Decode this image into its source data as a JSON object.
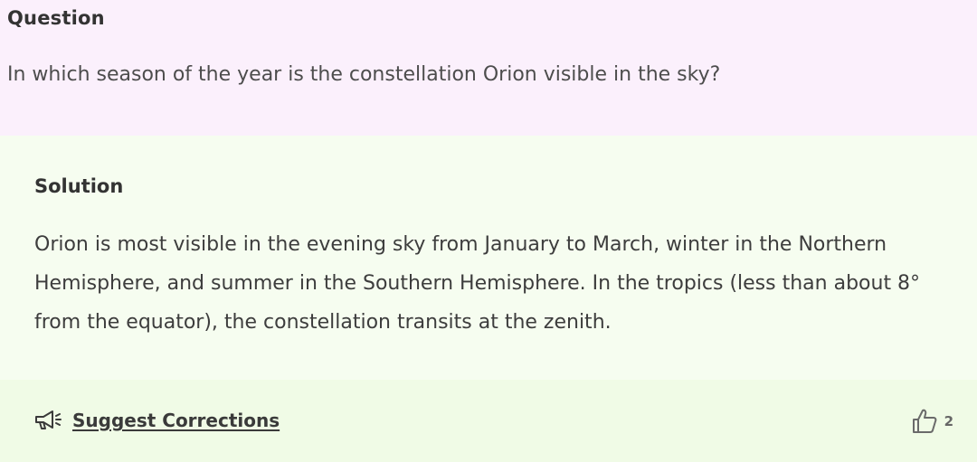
{
  "question": {
    "title": "Question",
    "text": "In which season of the year is the constellation Orion visible in the sky?"
  },
  "solution": {
    "title": "Solution",
    "text": "Orion is most visible in the evening sky from January to March, winter in the Northern Hemisphere, and summer in the Southern Hemisphere. In the tropics (less than about 8° from the equator), the constellation transits at the zenith."
  },
  "footer": {
    "suggest_label": "Suggest Corrections",
    "suggest_icon": "megaphone-icon",
    "like_icon": "thumbs-up-icon",
    "like_count": "2"
  },
  "colors": {
    "question_bg": "#fbf0fc",
    "solution_bg": "#f6fdf0",
    "footer_bg": "#f0fbe6"
  }
}
